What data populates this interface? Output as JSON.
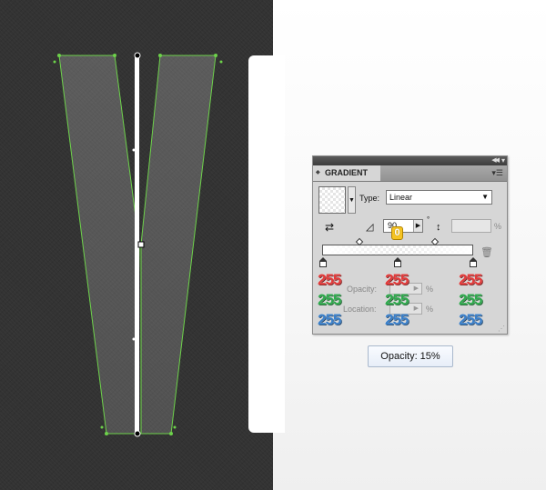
{
  "panel": {
    "tab_label": "GRADIENT",
    "type_label": "Type:",
    "type_value": "Linear",
    "angle_value": "90",
    "degree_symbol": "°",
    "aspect_suffix": "%",
    "opacity_label": "Opacity:",
    "location_label": "Location:",
    "percent_suffix": "%"
  },
  "color_values": {
    "left_stop": {
      "r": "255",
      "g": "255",
      "b": "255"
    },
    "middle_stop": {
      "r": "255",
      "g": "255",
      "b": "255"
    },
    "right_stop": {
      "r": "255",
      "g": "255",
      "b": "255"
    }
  },
  "stop_badge": "0",
  "tooltip": "Opacity: 15%",
  "colors": {
    "canvas_dark": "#333333",
    "path_green": "#6dd24a",
    "channel_red": "#e23a3a",
    "channel_green": "#2fa94d",
    "channel_blue": "#3a7fc9",
    "badge_yellow": "#f6c423"
  },
  "icons": {
    "panel_tab_arrows": "double-chevron-icon",
    "panel_menu": "panel-menu-icon",
    "reverse": "reverse-gradient-icon",
    "angle": "angle-icon",
    "aspect": "aspect-ratio-icon",
    "trash": "trash-icon"
  }
}
